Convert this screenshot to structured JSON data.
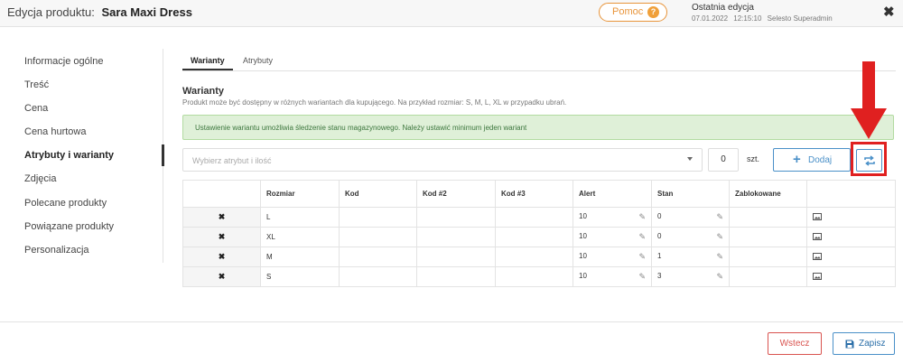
{
  "header": {
    "label": "Edycja produktu:",
    "product_name": "Sara Maxi Dress",
    "help_label": "Pomoc",
    "help_icon": "?",
    "last_edit_title": "Ostatnia edycja",
    "last_edit_date": "07.01.2022",
    "last_edit_time": "12:15:10",
    "last_edit_user": "Selesto Superadmin",
    "close_icon": "✖"
  },
  "sidebar": {
    "items": [
      {
        "label": "Informacje ogólne"
      },
      {
        "label": "Treść"
      },
      {
        "label": "Cena"
      },
      {
        "label": "Cena hurtowa"
      },
      {
        "label": "Atrybuty i warianty"
      },
      {
        "label": "Zdjęcia"
      },
      {
        "label": "Polecane produkty"
      },
      {
        "label": "Powiązane produkty"
      },
      {
        "label": "Personalizacja"
      }
    ],
    "active_index": 4
  },
  "tabs": [
    {
      "label": "Warianty"
    },
    {
      "label": "Atrybuty"
    }
  ],
  "variants": {
    "title": "Warianty",
    "description": "Produkt może być dostępny w różnych wariantach dla kupującego. Na przykład rozmiar: S, M, L, XL w przypadku ubrań.",
    "alert": "Ustawienie wariantu umożliwia śledzenie stanu magazynowego. Należy ustawić minimum jeden wariant",
    "select_placeholder": "Wybierz atrybut i ilość",
    "quantity": "0",
    "unit": "szt.",
    "add_label": "Dodaj"
  },
  "table": {
    "columns": [
      "",
      "Rozmiar",
      "Kod",
      "Kod #2",
      "Kod #3",
      "Alert",
      "Stan",
      "Zablokowane",
      ""
    ],
    "rows": [
      {
        "size": "L",
        "code": "",
        "code2": "",
        "code3": "",
        "alert": "10",
        "stock": "0"
      },
      {
        "size": "XL",
        "code": "",
        "code2": "",
        "code3": "",
        "alert": "10",
        "stock": "0"
      },
      {
        "size": "M",
        "code": "",
        "code2": "",
        "code3": "",
        "alert": "10",
        "stock": "1"
      },
      {
        "size": "S",
        "code": "",
        "code2": "",
        "code3": "",
        "alert": "10",
        "stock": "3"
      }
    ]
  },
  "footer": {
    "back_label": "Wstecz",
    "save_label": "Zapisz"
  },
  "colors": {
    "accent": "#4a90c8",
    "danger": "#d9534f",
    "help": "#e8943a",
    "success_bg": "#dff0d8",
    "highlight": "#e02020"
  }
}
